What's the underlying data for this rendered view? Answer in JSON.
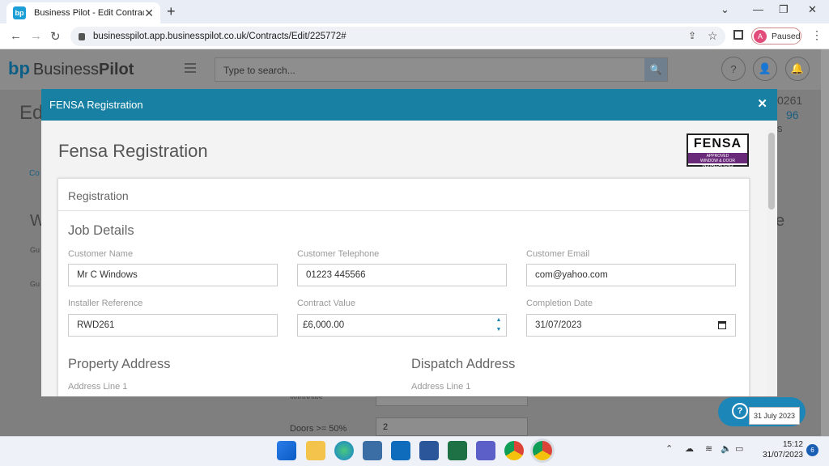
{
  "browser": {
    "tab_title": "Business Pilot - Edit Contract",
    "favicon_text": "bp",
    "url": "businesspilot.app.businesspilot.co.uk/Contracts/Edit/225772#",
    "profile_initial": "A",
    "profile_status": "Paused"
  },
  "app": {
    "logo_prefix": "Business",
    "logo_suffix": "Pilot",
    "logo_mark": "bp",
    "search_placeholder": "Type to search...",
    "bg_title": "Ed",
    "bg_breadcrumb": "Co",
    "bg_ref": "0261",
    "bg_num": "96",
    "bg_s": "s",
    "bg_w": "W",
    "bg_gu1": "Gu",
    "bg_gu2": "Gu",
    "bg_e": "e",
    "bg_windows": "Windows",
    "bg_doors_label": "Doors >= 50%",
    "bg_doors_value": "2"
  },
  "modal": {
    "title": "FENSA Registration",
    "heading": "Fensa Registration",
    "logo_text": "FENSA",
    "logo_sub1": "APPROVED",
    "logo_sub2": "WINDOW & DOOR INSTALLATIONS",
    "panel_title": "Registration",
    "job_details": "Job Details",
    "fields": {
      "customer_name_label": "Customer Name",
      "customer_name": "Mr C Windows",
      "customer_tel_label": "Customer Telephone",
      "customer_tel": "01223 445566",
      "customer_email_label": "Customer Email",
      "customer_email": "com@yahoo.com",
      "installer_ref_label": "Installer Reference",
      "installer_ref": "RWD261",
      "contract_value_label": "Contract Value",
      "contract_value": "£6,000.00",
      "completion_date_label": "Completion Date",
      "completion_date": "31/07/2023"
    },
    "property_address": "Property Address",
    "dispatch_address": "Dispatch Address",
    "address_line1_label": "Address Line 1"
  },
  "help_tooltip": "31 July 2023",
  "taskbar": {
    "time": "15:12",
    "date": "31/07/2023",
    "notifications": "6"
  }
}
